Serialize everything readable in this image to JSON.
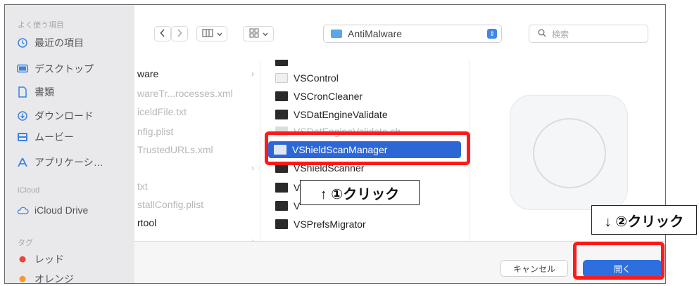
{
  "sidebar": {
    "favorites_header": "よく使う項目",
    "items": [
      {
        "label": "最近の項目",
        "icon": "clock-icon"
      },
      {
        "label": "デスクトップ",
        "icon": "desktop-icon"
      },
      {
        "label": "書類",
        "icon": "document-icon"
      },
      {
        "label": "ダウンロード",
        "icon": "download-icon"
      },
      {
        "label": "ムービー",
        "icon": "movie-icon"
      },
      {
        "label": "アプリケーシ…",
        "icon": "applications-icon"
      }
    ],
    "icloud_header": "iCloud",
    "icloud_drive": "iCloud Drive",
    "tags_header": "タグ",
    "tags": [
      {
        "label": "レッド",
        "color": "#e8443a"
      },
      {
        "label": "オレンジ",
        "color": "#f39a2b"
      }
    ]
  },
  "toolbar": {
    "path_label": "AntiMalware",
    "search_placeholder": "検索"
  },
  "column1": [
    {
      "label": "ware",
      "style": "dark",
      "chevron": true
    },
    {
      "label": "wareTr...rocesses.xml",
      "style": "faint"
    },
    {
      "label": "iceldFile.txt",
      "style": "faint"
    },
    {
      "label": "nfig.plist",
      "style": "faint"
    },
    {
      "label": "TrustedURLs.xml",
      "style": "faint"
    },
    {
      "label": "",
      "style": "faint",
      "chevron": true
    },
    {
      "label": "txt",
      "style": "faint"
    },
    {
      "label": "stallConfig.plist",
      "style": "faint"
    },
    {
      "label": "rtool",
      "style": "dark"
    },
    {
      "label": "",
      "style": "faint",
      "chevron": true
    }
  ],
  "column2": [
    {
      "label": "VSControl",
      "icon": "light"
    },
    {
      "label": "VSCronCleaner",
      "icon": "dark"
    },
    {
      "label": "VSDatEngineValidate",
      "icon": "dark"
    },
    {
      "label": "VSDatEngineValidate.sh",
      "icon": "faint",
      "faint": true
    },
    {
      "label": "VShieldScanManager",
      "icon": "light",
      "selected": true
    },
    {
      "label": "VShieldScanner",
      "icon": "dark"
    },
    {
      "label": "V",
      "icon": "dark"
    },
    {
      "label": "V",
      "icon": "dark"
    },
    {
      "label": "VSPrefsMigrator",
      "icon": "dark"
    }
  ],
  "buttons": {
    "cancel": "キャンセル",
    "open": "開く"
  },
  "annotations": {
    "step1": "↑ ①クリック",
    "step2": "↓ ②クリック"
  }
}
